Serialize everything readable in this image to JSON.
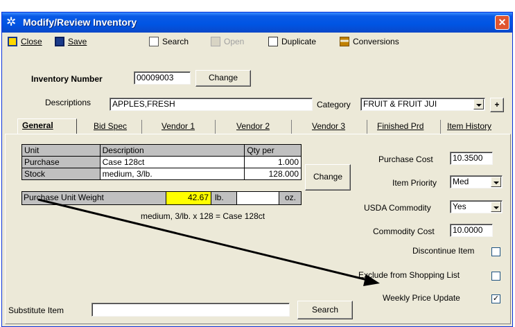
{
  "window": {
    "title": "Modify/Review Inventory",
    "close_glyph": "✕"
  },
  "toolbar": {
    "close": "Close",
    "save": "Save",
    "search": "Search",
    "open": "Open",
    "duplicate": "Duplicate",
    "conversions": "Conversions"
  },
  "header": {
    "inventory_number_label": "Inventory Number",
    "inventory_number": "00009003",
    "change_label": "Change",
    "descriptions_label": "Descriptions",
    "descriptions": "APPLES,FRESH",
    "category_label": "Category",
    "category": "FRUIT & FRUIT JUI",
    "plus_label": "+"
  },
  "tabs": [
    "General",
    "Bid Spec",
    "Vendor 1",
    "Vendor 2",
    "Vendor 3",
    "Finished Prd",
    "Item History"
  ],
  "units_table": {
    "columns": [
      "Unit",
      "Description",
      "Qty per"
    ],
    "rows": [
      {
        "unit": "Purchase",
        "description": "Case 128ct",
        "qty": "1.000"
      },
      {
        "unit": "Stock",
        "description": "medium, 3/lb.",
        "qty": "128.000"
      }
    ],
    "weight_label": "Purchase Unit Weight",
    "weight_lb": "42.67",
    "lb_unit": "lb.",
    "weight_oz": "",
    "oz_unit": "oz.",
    "change_label": "Change",
    "summary": "medium, 3/lb.  x  128 = Case 128ct"
  },
  "right": {
    "purchase_cost_label": "Purchase Cost",
    "purchase_cost": "10.3500",
    "item_priority_label": "Item Priority",
    "item_priority": "Med",
    "usda_label": "USDA Commodity",
    "usda": "Yes",
    "commodity_cost_label": "Commodity Cost",
    "commodity_cost": "10.0000",
    "discontinue_label": "Discontinue Item",
    "discontinue_checked": false,
    "exclude_label": "Exclude from Shopping List",
    "exclude_checked": false,
    "weekly_label": "Weekly Price Update",
    "weekly_checked": true,
    "check_glyph": "✓"
  },
  "bottom": {
    "substitute_label": "Substitute Item",
    "substitute": "",
    "search_label": "Search"
  },
  "colors": {
    "title_bar": "#0054e3",
    "highlight": "#ffff00",
    "window_bg": "#ece9d8"
  }
}
